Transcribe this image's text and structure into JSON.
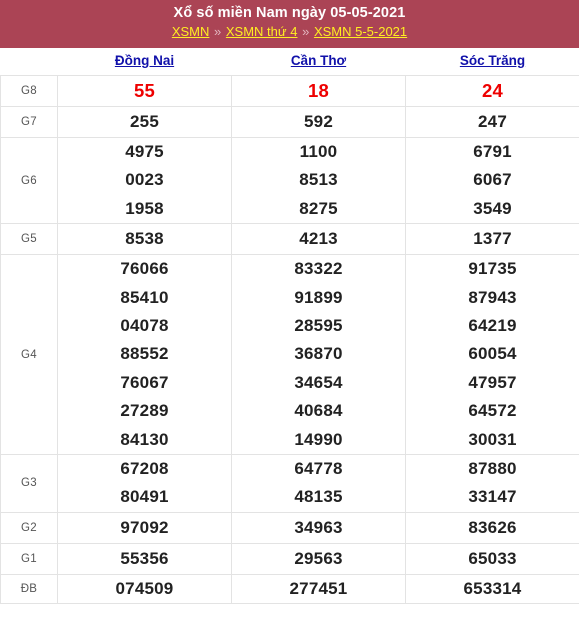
{
  "banner": {
    "title": "Xổ số miền Nam ngày 05-05-2021",
    "breadcrumb": [
      {
        "label": "XSMN"
      },
      {
        "label": "XSMN thứ 4"
      },
      {
        "label": "XSMN 5-5-2021"
      }
    ],
    "separator": "»",
    "background_color": "#ab4455",
    "title_color": "#ffffff",
    "link_color": "#ffee22"
  },
  "table": {
    "provinces": [
      {
        "name": "Đồng Nai"
      },
      {
        "name": "Cần Thơ"
      },
      {
        "name": "Sóc Trăng"
      }
    ],
    "province_link_color": "#1111aa",
    "highlight_color": "#ee0000",
    "rows": [
      {
        "prize": "G8",
        "highlight": true,
        "values": [
          [
            "55"
          ],
          [
            "18"
          ],
          [
            "24"
          ]
        ]
      },
      {
        "prize": "G7",
        "highlight": false,
        "values": [
          [
            "255"
          ],
          [
            "592"
          ],
          [
            "247"
          ]
        ]
      },
      {
        "prize": "G6",
        "highlight": false,
        "values": [
          [
            "4975",
            "0023",
            "1958"
          ],
          [
            "1100",
            "8513",
            "8275"
          ],
          [
            "6791",
            "6067",
            "3549"
          ]
        ]
      },
      {
        "prize": "G5",
        "highlight": false,
        "values": [
          [
            "8538"
          ],
          [
            "4213"
          ],
          [
            "1377"
          ]
        ]
      },
      {
        "prize": "G4",
        "highlight": false,
        "values": [
          [
            "76066",
            "85410",
            "04078",
            "88552",
            "76067",
            "27289",
            "84130"
          ],
          [
            "83322",
            "91899",
            "28595",
            "36870",
            "34654",
            "40684",
            "14990"
          ],
          [
            "91735",
            "87943",
            "64219",
            "60054",
            "47957",
            "64572",
            "30031"
          ]
        ]
      },
      {
        "prize": "G3",
        "highlight": false,
        "values": [
          [
            "67208",
            "80491"
          ],
          [
            "64778",
            "48135"
          ],
          [
            "87880",
            "33147"
          ]
        ]
      },
      {
        "prize": "G2",
        "highlight": false,
        "values": [
          [
            "97092"
          ],
          [
            "34963"
          ],
          [
            "83626"
          ]
        ]
      },
      {
        "prize": "G1",
        "highlight": false,
        "values": [
          [
            "55356"
          ],
          [
            "29563"
          ],
          [
            "65033"
          ]
        ]
      },
      {
        "prize": "ĐB",
        "highlight": true,
        "values": [
          [
            "074509"
          ],
          [
            "277451"
          ],
          [
            "653314"
          ]
        ]
      }
    ]
  }
}
